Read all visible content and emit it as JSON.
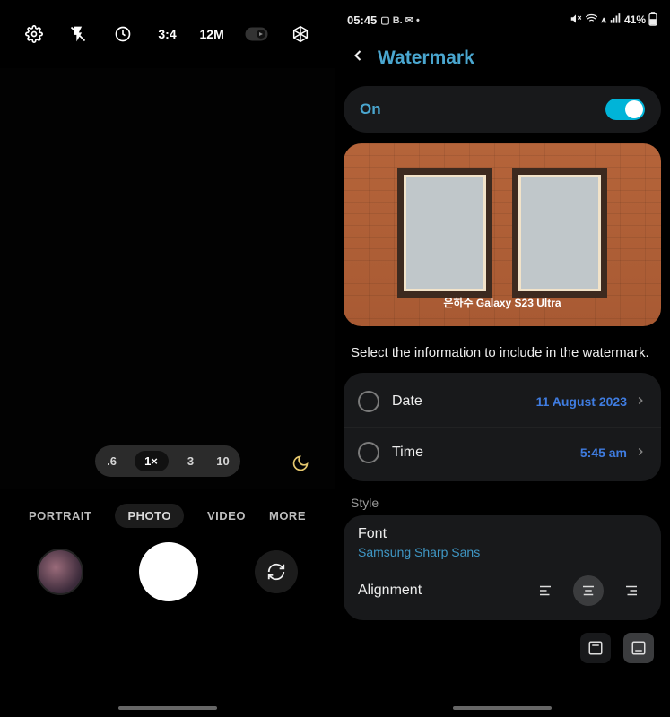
{
  "camera": {
    "toolbar": {
      "ratio": "3:4",
      "resolution": "12M"
    },
    "zoom": [
      ".6",
      "1×",
      "3",
      "10"
    ],
    "zoom_active": "1×",
    "modes": [
      "PORTRAIT",
      "PHOTO",
      "VIDEO",
      "MORE"
    ],
    "mode_active": "PHOTO"
  },
  "status": {
    "time": "05:45",
    "indicators_left": "▢ B. ✉ •",
    "battery": "41%"
  },
  "watermark": {
    "title": "Watermark",
    "toggle_label": "On",
    "toggle_state": true,
    "preview_text": "은하수 Galaxy S23 Ultra",
    "description": "Select the information to include in the watermark.",
    "items": [
      {
        "label": "Date",
        "value": "11 August 2023"
      },
      {
        "label": "Time",
        "value": "5:45 am"
      }
    ],
    "style_heading": "Style",
    "font_label": "Font",
    "font_value": "Samsung Sharp Sans",
    "alignment_label": "Alignment"
  }
}
